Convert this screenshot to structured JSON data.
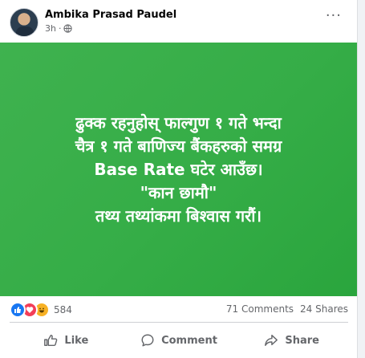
{
  "post": {
    "author": "Ambika Prasad Paudel",
    "time": "3h",
    "more": "···"
  },
  "image_text": {
    "line1": "ढुक्क रहनुहोस् फाल्गुण १ गते भन्दा",
    "line2": "चैत्र १ गते बाणिज्य बैंकहरुको समग्र",
    "line3": "Base Rate घटेर आउँछ।",
    "line4": "\"कान छामौ\"",
    "line5": "तथ्य तथ्यांकमा बिश्वास गरौं।"
  },
  "stats": {
    "reaction_count": "584",
    "comments": "71 Comments",
    "shares": "24 Shares"
  },
  "actions": {
    "like": "Like",
    "comment": "Comment",
    "share": "Share"
  },
  "colors": {
    "image_bg": "#35ad47",
    "like": "#1877f2",
    "love": "#f33e58",
    "haha": "#f7b125"
  }
}
